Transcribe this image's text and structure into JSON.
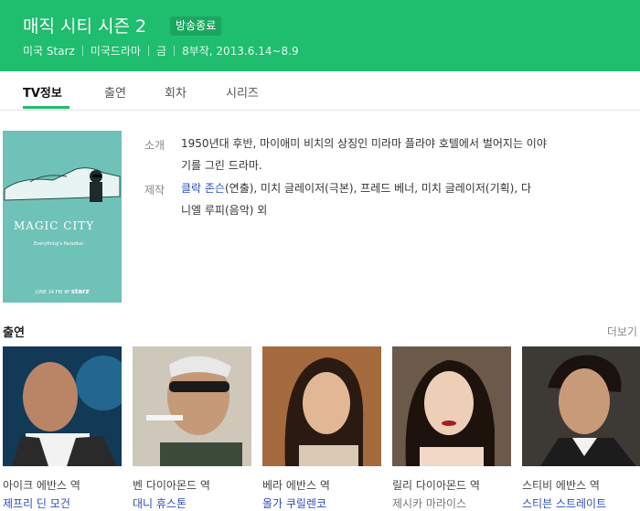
{
  "header": {
    "title": "매직 시티 시즌 2",
    "badge": "방송종료",
    "meta": [
      "미국 Starz",
      "미국드라마",
      "금",
      "8부작, 2013.6.14~8.9"
    ]
  },
  "tabs": [
    {
      "label": "TV정보",
      "active": true
    },
    {
      "label": "출연",
      "active": false
    },
    {
      "label": "회차",
      "active": false
    },
    {
      "label": "시리즈",
      "active": false
    }
  ],
  "poster": {
    "title": "MAGIC CITY",
    "subtitle": "Everything's Paradise",
    "date": "JUNE 14 FRI 9P",
    "network": "starz",
    "colors": {
      "bg": "#6fc2b8"
    }
  },
  "info": {
    "intro_label": "소개",
    "intro_line1": "1950년대 후반, 마이애미 비치의 상징인 미라마 플라야 호텔에서 벌어지는 이야",
    "intro_line2": "기를 그린 드라마.",
    "production_label": "제작",
    "director": "클락 존슨",
    "director_role": "(연출), 미치 글레이저(극본), 프레드 베너, 미치 글레이저(기획), 다",
    "production_line2": "니엘 루피(음악) 외"
  },
  "cast_section": {
    "title": "출연",
    "more": "더보기"
  },
  "cast": [
    {
      "role": "아이크 에반스 역",
      "actor": "제프리 딘 모건",
      "linked": true
    },
    {
      "role": "벤 다이아몬드 역",
      "actor": "대니 휴스톤",
      "linked": true
    },
    {
      "role": "베라 에반스 역",
      "actor": "올가 쿠릴렌코",
      "linked": true
    },
    {
      "role": "릴리 다이아몬드 역",
      "actor": "제시카 마라이스",
      "linked": false
    },
    {
      "role": "스티비 에반스 역",
      "actor": "스티븐 스트레이트",
      "linked": true
    }
  ],
  "colors": {
    "accent": "#1fbd6e",
    "link": "#2a4ebd"
  }
}
